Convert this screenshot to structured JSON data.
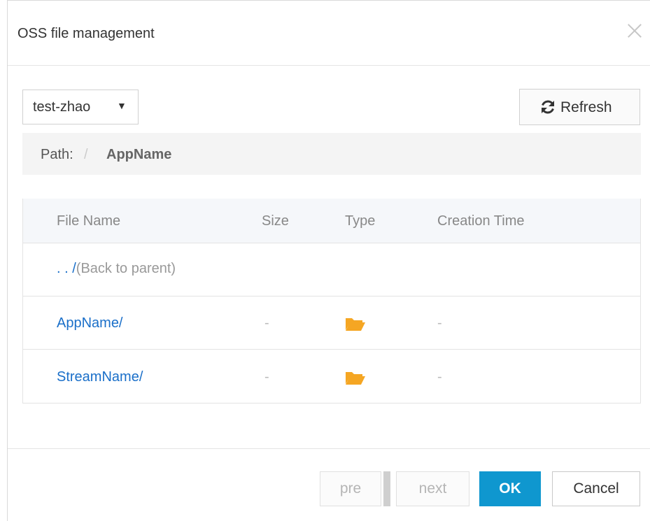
{
  "dialog": {
    "title": "OSS file management",
    "close_icon": "close-icon"
  },
  "toolbar": {
    "bucket_value": "test-zhao",
    "bucket_caret": "▼",
    "refresh_label": "Refresh",
    "refresh_icon": "refresh-icon"
  },
  "path": {
    "label": "Path:",
    "separator": "/",
    "current": "AppName"
  },
  "table": {
    "columns": [
      "File Name",
      "Size",
      "Type",
      "Creation Time"
    ],
    "back_row": {
      "dots": ". . /",
      "text": "(Back to parent)"
    },
    "rows": [
      {
        "name": "AppName/",
        "size": "-",
        "type_icon": "folder-icon",
        "created": "-"
      },
      {
        "name": "StreamName/",
        "size": "-",
        "type_icon": "folder-icon",
        "created": "-"
      }
    ]
  },
  "footer": {
    "pre_label": "pre",
    "next_label": "next",
    "ok_label": "OK",
    "cancel_label": "Cancel"
  },
  "colors": {
    "accent": "#0f97cf",
    "link": "#1a6fc9",
    "folder": "#f5a623"
  }
}
